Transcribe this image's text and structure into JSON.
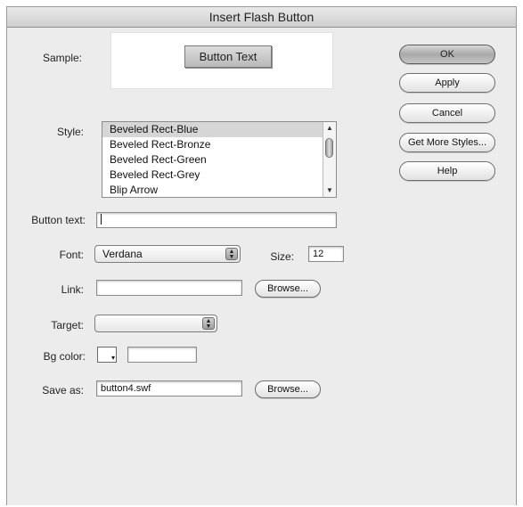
{
  "window": {
    "title": "Insert Flash Button"
  },
  "labels": {
    "sample": "Sample:",
    "style": "Style:",
    "button_text": "Button text:",
    "font": "Font:",
    "size": "Size:",
    "link": "Link:",
    "target": "Target:",
    "bg_color": "Bg color:",
    "save_as": "Save as:"
  },
  "sample": {
    "button_label": "Button Text"
  },
  "styles": {
    "items": [
      "Beveled Rect-Blue",
      "Beveled Rect-Bronze",
      "Beveled Rect-Green",
      "Beveled Rect-Grey",
      "Blip Arrow"
    ],
    "selected_index": 0
  },
  "fields": {
    "button_text": "",
    "font": "Verdana",
    "size": "12",
    "link": "",
    "target": "",
    "bg_color": "",
    "save_as": "button4.swf"
  },
  "buttons": {
    "ok": "OK",
    "apply": "Apply",
    "cancel": "Cancel",
    "get_more_styles": "Get More Styles...",
    "help": "Help",
    "browse": "Browse..."
  }
}
